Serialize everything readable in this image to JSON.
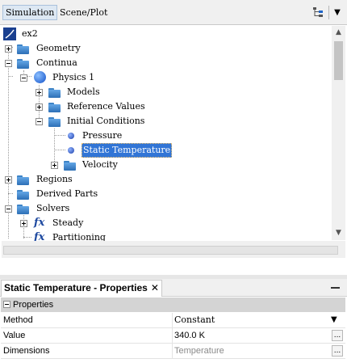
{
  "tabs": {
    "active": "Simulation",
    "inactive": "Scene/Plot"
  },
  "toolbar": {
    "tree_icon": "hierarchy-icon",
    "dropdown_icon": "dropdown-arrow-icon"
  },
  "tree": {
    "root": "ex2",
    "geometry": "Geometry",
    "continua": "Continua",
    "physics": "Physics 1",
    "models": "Models",
    "reference_values": "Reference Values",
    "initial_conditions": "Initial Conditions",
    "pressure": "Pressure",
    "static_temperature": "Static Temperature",
    "velocity": "Velocity",
    "regions": "Regions",
    "derived_parts": "Derived Parts",
    "solvers": "Solvers",
    "steady": "Steady",
    "partitioning": "Partitioning",
    "fx_glyph": "fx"
  },
  "properties": {
    "panel_title": "Static Temperature - Properties",
    "close_glyph": "✕",
    "section": "Properties",
    "rows": [
      {
        "name": "Method",
        "value": "Constant"
      },
      {
        "name": "Value",
        "value": "340.0 K"
      },
      {
        "name": "Dimensions",
        "value": "Temperature"
      }
    ],
    "ellipsis": "..."
  },
  "colors": {
    "selection": "#3175d6",
    "folder": "#3f86cc",
    "tab_active_bg": "#dde8f3"
  }
}
